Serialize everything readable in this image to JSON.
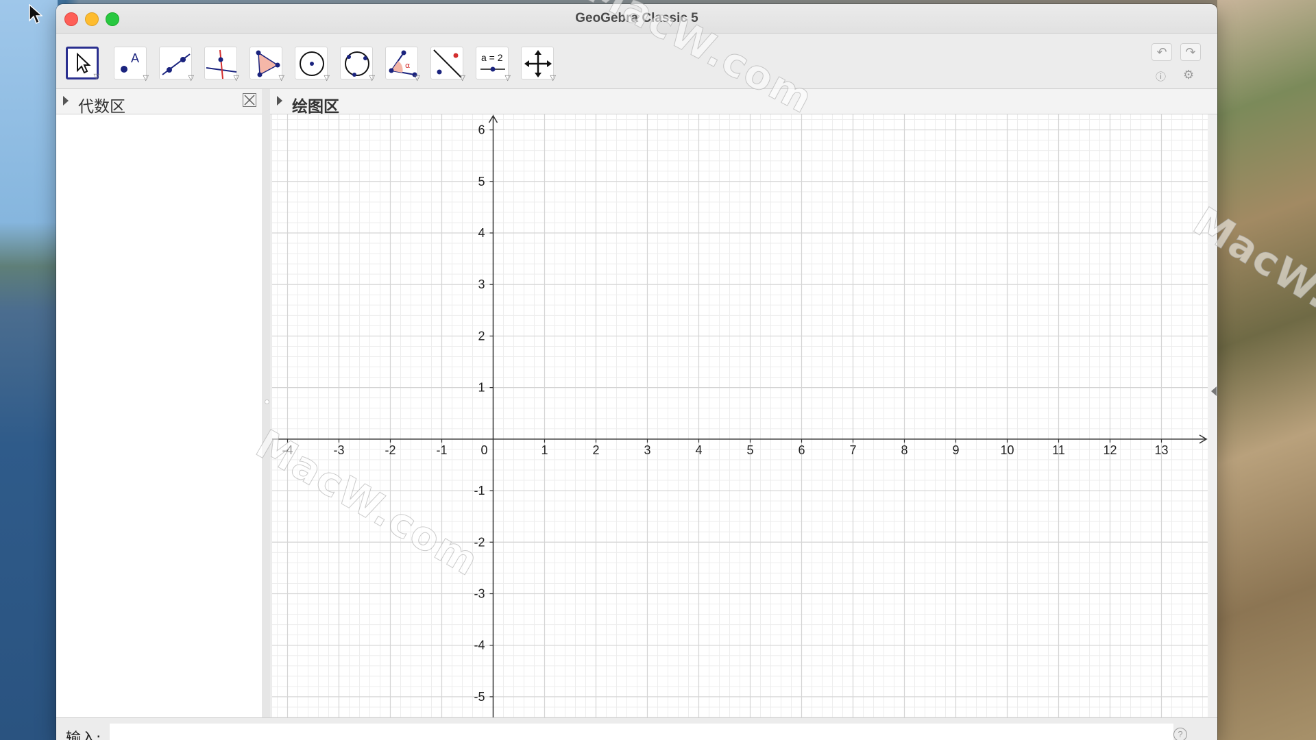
{
  "window": {
    "title": "GeoGebra Classic 5"
  },
  "toolbar": {
    "tools": [
      {
        "name": "move-tool",
        "icon": "arrow-pointer-icon"
      },
      {
        "name": "point-tool",
        "icon": "point-a-icon"
      },
      {
        "name": "line-tool",
        "icon": "line-through-points-icon"
      },
      {
        "name": "perpendicular-line-tool",
        "icon": "perpendicular-line-icon"
      },
      {
        "name": "polygon-tool",
        "icon": "polygon-icon"
      },
      {
        "name": "circle-center-point-tool",
        "icon": "circle-center-icon"
      },
      {
        "name": "circle-three-points-tool",
        "icon": "circle-three-points-icon"
      },
      {
        "name": "angle-tool",
        "icon": "angle-icon"
      },
      {
        "name": "reflect-tool",
        "icon": "reflect-about-line-icon"
      },
      {
        "name": "slider-tool",
        "icon": "slider-icon",
        "label": "a = 2"
      },
      {
        "name": "move-graphics-view-tool",
        "icon": "move-cross-icon"
      }
    ],
    "undo_icon": "undo-icon",
    "redo_icon": "redo-icon",
    "help_icon": "help-icon",
    "settings_icon": "gear-icon"
  },
  "algebra_view": {
    "title": "代数区"
  },
  "graphics_view": {
    "title": "绘图区",
    "x_axis": {
      "min": -4.3,
      "max": 13.9,
      "tick_labels": [
        "-4",
        "-3",
        "-2",
        "-1",
        "0",
        "1",
        "2",
        "3",
        "4",
        "5",
        "6",
        "7",
        "8",
        "9",
        "10",
        "11",
        "12",
        "13"
      ],
      "ticks": [
        -4,
        -3,
        -2,
        -1,
        0,
        1,
        2,
        3,
        4,
        5,
        6,
        7,
        8,
        9,
        10,
        11,
        12,
        13
      ]
    },
    "y_axis": {
      "min": -5.4,
      "max": 6.3,
      "tick_labels": [
        "6",
        "5",
        "4",
        "3",
        "2",
        "1",
        "-1",
        "-2",
        "-3",
        "-4",
        "-5"
      ],
      "ticks": [
        6,
        5,
        4,
        3,
        2,
        1,
        -1,
        -2,
        -3,
        -4,
        -5
      ]
    },
    "major_grid": true,
    "minor_grid": true,
    "colors": {
      "major_grid": "#d4d4d4",
      "minor_grid": "#ededed",
      "axis": "#333333"
    }
  },
  "input_bar": {
    "label": "输入:",
    "value": "",
    "placeholder": ""
  },
  "watermark": {
    "text": "MacW.com"
  }
}
